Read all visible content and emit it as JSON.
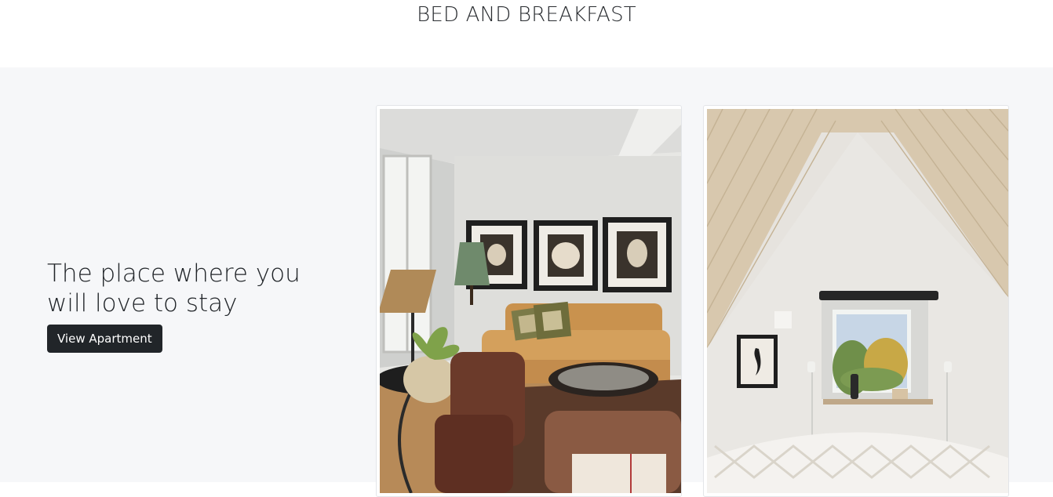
{
  "header": {
    "title": "BED AND BREAKFAST"
  },
  "hero": {
    "tagline": "The place where you will love to stay",
    "button_label": "View Apartment"
  },
  "gallery": {
    "images": [
      {
        "name": "living-room-photo"
      },
      {
        "name": "attic-bedroom-photo"
      }
    ]
  },
  "colors": {
    "page_background": "#ffffff",
    "hero_background": "#f6f7f9",
    "button_background": "#212529",
    "button_text": "#ffffff"
  }
}
